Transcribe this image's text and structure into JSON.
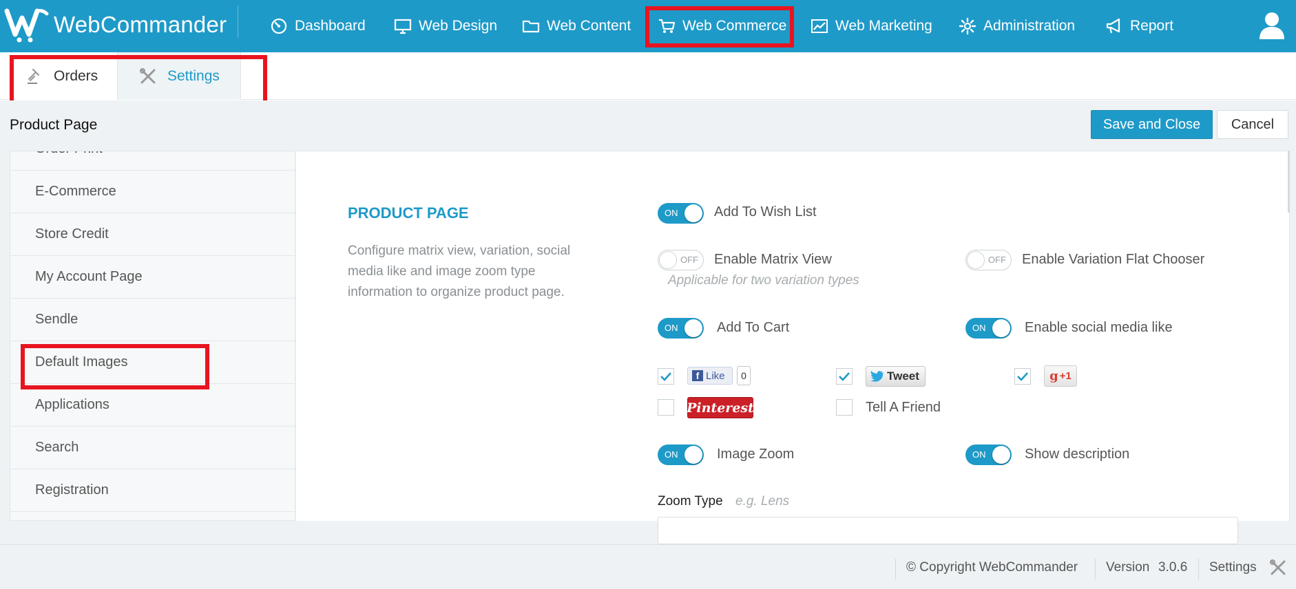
{
  "brand": {
    "name": "WebCommander"
  },
  "topnav": {
    "items": [
      {
        "label": "Dashboard",
        "icon": "dashboard-icon"
      },
      {
        "label": "Web Design",
        "icon": "monitor-icon"
      },
      {
        "label": "Web Content",
        "icon": "folder-icon"
      },
      {
        "label": "Web Commerce",
        "icon": "cart-icon"
      },
      {
        "label": "Web Marketing",
        "icon": "chart-icon"
      },
      {
        "label": "Administration",
        "icon": "gear-icon"
      },
      {
        "label": "Report",
        "icon": "megaphone-icon"
      }
    ],
    "active": "Web Commerce",
    "user_icon": "user-icon"
  },
  "subtabs": {
    "orders": "Orders",
    "settings": "Settings",
    "active": "Settings"
  },
  "page": {
    "title": "Product Page",
    "save_label": "Save and Close",
    "cancel_label": "Cancel"
  },
  "sidebar": {
    "items": [
      {
        "label": "Order Print"
      },
      {
        "label": "E-Commerce"
      },
      {
        "label": "Store Credit"
      },
      {
        "label": "My Account Page"
      },
      {
        "label": "Sendle"
      },
      {
        "label": "Default Images"
      },
      {
        "label": "Applications"
      },
      {
        "label": "Search"
      },
      {
        "label": "Registration"
      }
    ]
  },
  "section": {
    "title": "PRODUCT PAGE",
    "description": "Configure matrix view, variation, social media like and image zoom type information to organize product page."
  },
  "options": {
    "on_text": "ON",
    "off_text": "OFF",
    "add_to_wish_list": {
      "label": "Add To Wish List",
      "state": "ON"
    },
    "enable_matrix_view": {
      "label": "Enable Matrix View",
      "state": "OFF",
      "hint": "Applicable for two variation types"
    },
    "enable_variation_flat_chooser": {
      "label": "Enable Variation Flat Chooser",
      "state": "OFF"
    },
    "add_to_cart": {
      "label": "Add To Cart",
      "state": "ON"
    },
    "enable_social_media_like": {
      "label": "Enable social media like",
      "state": "ON"
    },
    "image_zoom": {
      "label": "Image Zoom",
      "state": "ON"
    },
    "show_description": {
      "label": "Show description",
      "state": "ON"
    }
  },
  "social": {
    "facebook": {
      "label": "Like",
      "count": "0",
      "checked": true
    },
    "twitter": {
      "label": "Tweet",
      "checked": true
    },
    "googleplus": {
      "label": "+1",
      "checked": true
    },
    "pinterest": {
      "label": "Pinterest",
      "checked": false
    },
    "tell_a_friend": {
      "label": "Tell A Friend",
      "checked": false
    }
  },
  "zoom": {
    "label": "Zoom Type",
    "placeholder": "e.g. Lens",
    "value": ""
  },
  "footer": {
    "copyright": "© Copyright WebCommander",
    "version_label": "Version",
    "version": "3.0.6",
    "settings_label": "Settings"
  },
  "colors": {
    "primary": "#1e9ac8",
    "highlight": "#e8141f",
    "pinterest": "#cb2027"
  }
}
